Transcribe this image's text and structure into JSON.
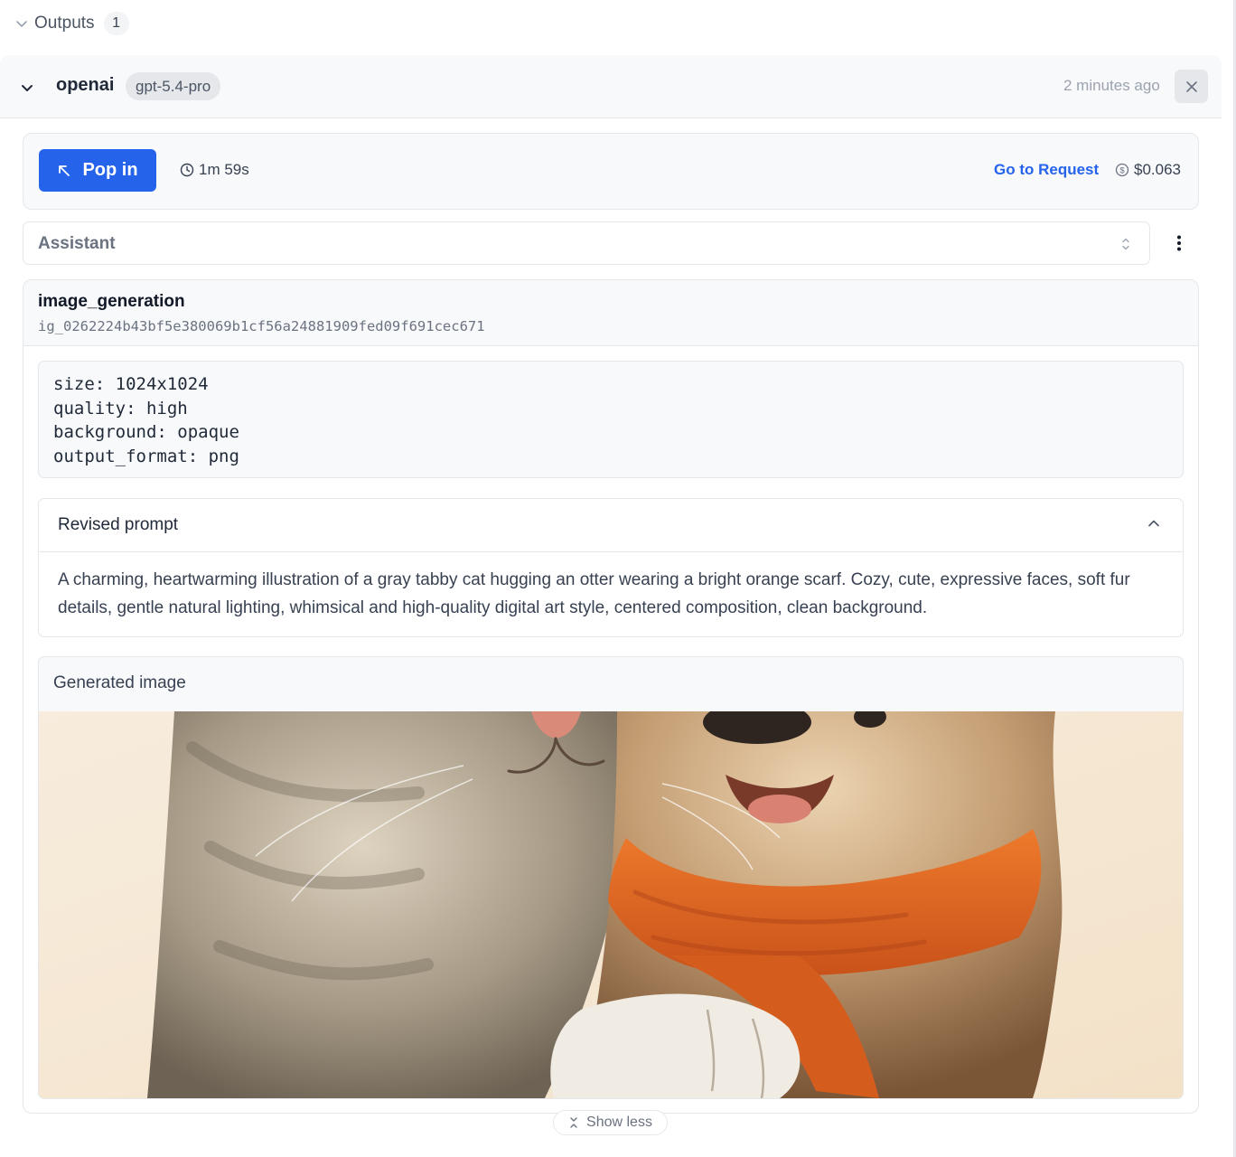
{
  "outputs": {
    "title": "Outputs",
    "count": "1"
  },
  "provider": {
    "name": "openai",
    "model": "gpt-5.4-pro",
    "time_ago": "2 minutes ago"
  },
  "toolbar": {
    "pop_in_label": "Pop in",
    "duration": "1m 59s",
    "go_to_request_label": "Go to Request",
    "cost": "$0.063"
  },
  "role_select": {
    "value": "Assistant"
  },
  "image_generation": {
    "title": "image_generation",
    "id": "ig_0262224b43bf5e380069b1cf56a24881909fed09f691cec671",
    "params": [
      "size: 1024x1024",
      "quality: high",
      "background: opaque",
      "output_format: png"
    ],
    "revised_prompt_title": "Revised prompt",
    "revised_prompt_text": "A charming, heartwarming illustration of a gray tabby cat hugging an otter wearing a bright orange scarf. Cozy, cute, expressive faces, soft fur details, gentle natural lighting, whimsical and high-quality digital art style, centered composition, clean background.",
    "generated_image_title": "Generated image"
  },
  "footer": {
    "show_less_label": "Show less"
  },
  "colors": {
    "accent": "#2563eb",
    "scarf": "#e0601c",
    "image_background": "#f6e9d6"
  },
  "icons": [
    "chevron-down-icon",
    "close-icon",
    "arrow-up-left-icon",
    "clock-icon",
    "dollar-circle-icon",
    "chevron-up-down-icon",
    "more-vertical-icon",
    "chevron-up-icon",
    "collapse-icon"
  ]
}
